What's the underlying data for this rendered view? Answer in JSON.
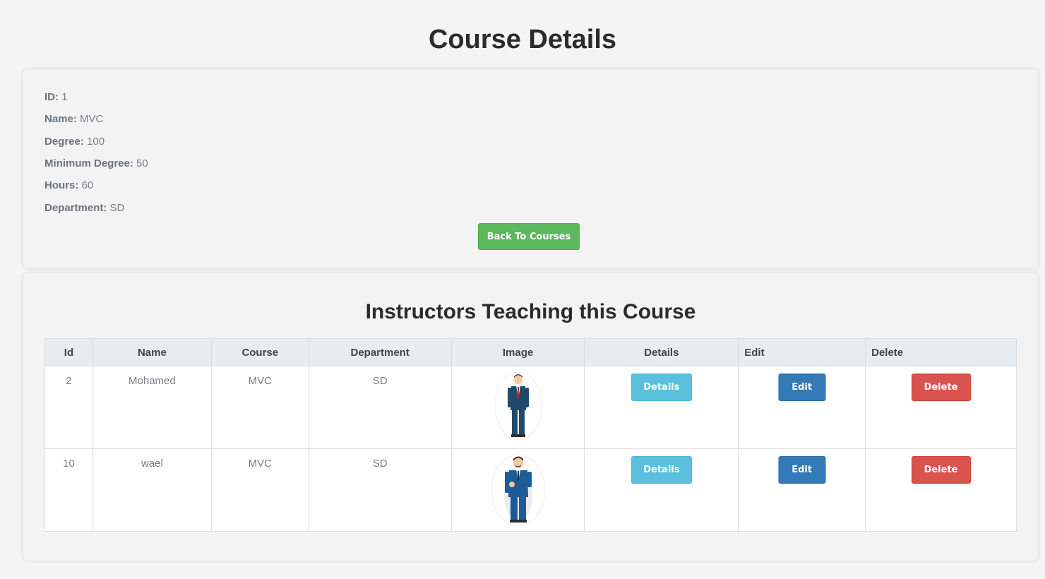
{
  "page": {
    "title": "Course Details"
  },
  "course": {
    "fields": [
      {
        "label": "ID:",
        "value": "1"
      },
      {
        "label": "Name:",
        "value": "MVC"
      },
      {
        "label": "Degree:",
        "value": "100"
      },
      {
        "label": "Minimum Degree:",
        "value": "50"
      },
      {
        "label": "Hours:",
        "value": "60"
      },
      {
        "label": "Department:",
        "value": "SD"
      }
    ],
    "back_button": "Back To Courses"
  },
  "instructors": {
    "title": "Instructors Teaching this Course",
    "columns": [
      "Id",
      "Name",
      "Course",
      "Department",
      "Image",
      "Details",
      "Edit",
      "Delete"
    ],
    "rows": [
      {
        "id": "2",
        "name": "Mohamed",
        "course": "MVC",
        "department": "SD",
        "image": "businessman-avatar-icon",
        "details": "Details",
        "edit": "Edit",
        "delete": "Delete"
      },
      {
        "id": "10",
        "name": "wael",
        "course": "MVC",
        "department": "SD",
        "image": "businessman-mustache-avatar-icon",
        "details": "Details",
        "edit": "Edit",
        "delete": "Delete"
      }
    ]
  },
  "colors": {
    "success": "#5cb85c",
    "info": "#5bc0de",
    "primary": "#337ab7",
    "danger": "#d9534f"
  }
}
